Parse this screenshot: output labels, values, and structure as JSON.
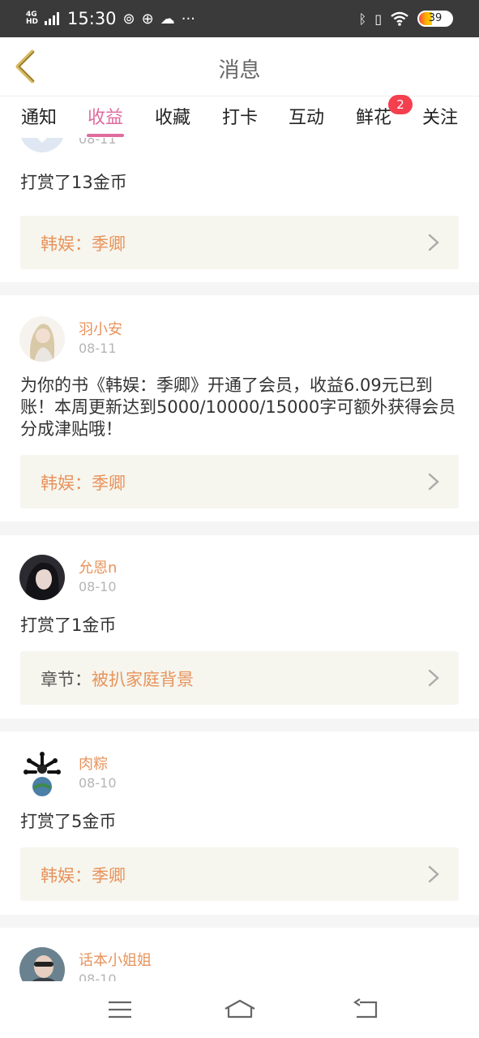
{
  "status_bar": {
    "network": "4G",
    "network_hd": "HD",
    "time": "15:30",
    "battery": "39",
    "battery_level": 0.39
  },
  "header": {
    "title": "消息",
    "back_icon": "chevron-left-icon"
  },
  "tabs": [
    {
      "label": "通知",
      "active": false
    },
    {
      "label": "收益",
      "active": true
    },
    {
      "label": "收藏",
      "active": false
    },
    {
      "label": "打卡",
      "active": false
    },
    {
      "label": "互动",
      "active": false
    },
    {
      "label": "鲜花",
      "active": false,
      "badge": "2"
    },
    {
      "label": "关注",
      "active": false
    }
  ],
  "messages": [
    {
      "date": "08-11",
      "text": "打赏了13金币",
      "link_label": "韩娱：",
      "link_value": "季卿"
    },
    {
      "user": "羽小安",
      "date": "08-11",
      "text": "为你的书《韩娱：季卿》开通了会员，收益6.09元已到账！本周更新达到5000/10000/15000字可额外获得会员分成津贴哦！",
      "link_label": "韩娱：",
      "link_value": "季卿"
    },
    {
      "user": "允恩n",
      "date": "08-10",
      "text": "打赏了1金币",
      "link_label": "章节：",
      "link_value": "被扒家庭背景"
    },
    {
      "user": "肉粽",
      "date": "08-10",
      "text": "打赏了5金币",
      "link_label": "韩娱：",
      "link_value": "季卿"
    },
    {
      "user": "话本小姐姐",
      "date": "08-10"
    }
  ],
  "colors": {
    "accent": "#e06c9f",
    "link": "#e8935c",
    "badge": "#f43f4f"
  }
}
